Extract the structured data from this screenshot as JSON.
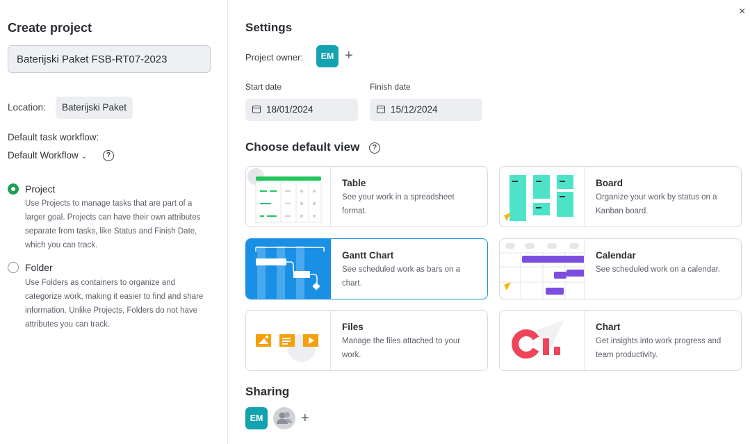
{
  "close_label": "×",
  "create": {
    "title": "Create project",
    "name_value": "Baterijski Paket FSB-RT07-2023",
    "location_label": "Location:",
    "location_value": "Baterijski Paket",
    "workflow_label": "Default task workflow:",
    "workflow_value": "Default Workflow",
    "help_glyph": "?",
    "options": [
      {
        "title": "Project",
        "selected": true,
        "description": "Use Projects to manage tasks that are part of a larger goal. Projects can have their own attributes separate from tasks, like Status and Finish Date, which you can track."
      },
      {
        "title": "Folder",
        "selected": false,
        "description": "Use Folders as containers to organize and categorize work, making it easier to find and share information. Unlike Projects, Folders do not have attributes you can track."
      }
    ]
  },
  "settings": {
    "title": "Settings",
    "owner_label": "Project owner:",
    "owner_initials": "EM",
    "plus": "+",
    "start_label": "Start date",
    "start_value": "18/01/2024",
    "finish_label": "Finish date",
    "finish_value": "15/12/2024"
  },
  "views": {
    "title": "Choose default view",
    "selected": "Gantt Chart",
    "cards": [
      {
        "title": "Table",
        "description": "See your work in a spreadsheet format."
      },
      {
        "title": "Board",
        "description": "Organize your work by status on a Kanban board."
      },
      {
        "title": "Gantt Chart",
        "description": "See scheduled work as bars on a chart."
      },
      {
        "title": "Calendar",
        "description": "See scheduled work on a calendar."
      },
      {
        "title": "Files",
        "description": "Manage the files attached to your work."
      },
      {
        "title": "Chart",
        "description": "Get insights into work progress and team productivity."
      }
    ]
  },
  "sharing": {
    "title": "Sharing",
    "member_initials": "EM",
    "plus": "+"
  },
  "colors": {
    "accent_blue": "#1a8fe6",
    "avatar_teal": "#13a3b0",
    "radio_green": "#1f9e54",
    "table_green": "#22c55e",
    "board_teal": "#4de3c8",
    "calendar_purple": "#7c4ddf",
    "files_orange": "#f5a00b",
    "chart_red": "#f0445a"
  }
}
